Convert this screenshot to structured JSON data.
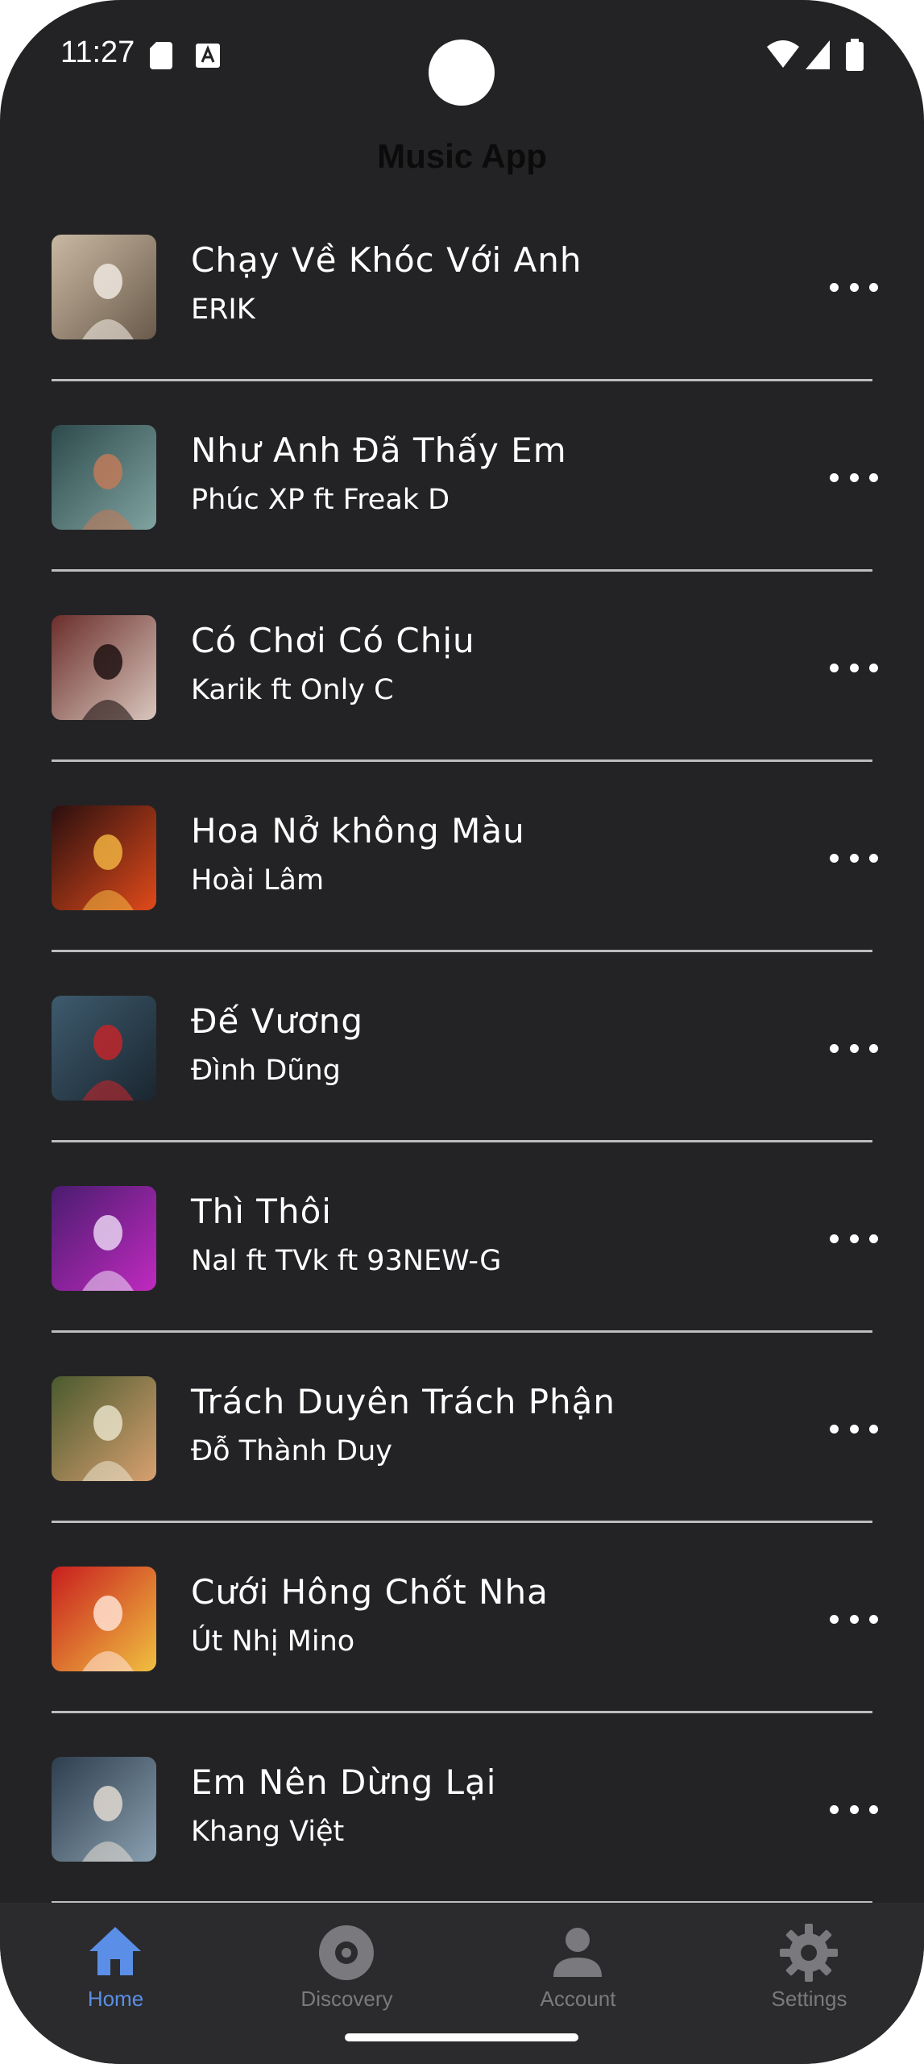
{
  "status_bar": {
    "time": "11:27"
  },
  "app": {
    "title": "Music App"
  },
  "songs": [
    {
      "title": "Chạy Về Khóc Với Anh",
      "artist": "ERIK",
      "cover_colors": [
        "#c9b9a3",
        "#6a5a4a",
        "#efe8df"
      ]
    },
    {
      "title": "Như Anh Đã Thấy Em",
      "artist": "Phúc XP ft Freak D",
      "cover_colors": [
        "#2e4a4c",
        "#7fa3a0",
        "#c07a5a"
      ]
    },
    {
      "title": "Có Chơi Có Chịu",
      "artist": "Karik ft Only C",
      "cover_colors": [
        "#6b2e2a",
        "#d8c6bd",
        "#1e1212"
      ]
    },
    {
      "title": "Hoa Nở không Màu",
      "artist": "Hoài Lâm",
      "cover_colors": [
        "#2a0f0f",
        "#e04a1a",
        "#f0b040"
      ]
    },
    {
      "title": "Đế Vương",
      "artist": "Đình Dũng",
      "cover_colors": [
        "#3e5b6e",
        "#1a2630",
        "#c0262b"
      ]
    },
    {
      "title": "Thì Thôi",
      "artist": "Nal ft TVk ft 93NEW-G",
      "cover_colors": [
        "#4a1c6e",
        "#c02ac0",
        "#e8d0f0"
      ]
    },
    {
      "title": "Trách Duyên Trách Phận",
      "artist": "Đỗ Thành Duy",
      "cover_colors": [
        "#4a5a2e",
        "#d8a070",
        "#e8e0c8"
      ]
    },
    {
      "title": "Cưới Hông Chốt Nha",
      "artist": "Út Nhị Mino",
      "cover_colors": [
        "#c81e1e",
        "#f0c040",
        "#ffe0d0"
      ]
    },
    {
      "title": "Em Nên Dừng Lại",
      "artist": "Khang Việt",
      "cover_colors": [
        "#2e3e4e",
        "#8aa0b0",
        "#e0d8d0"
      ]
    }
  ],
  "bottom_nav": [
    {
      "label": "Home",
      "icon": "home-icon",
      "active": true
    },
    {
      "label": "Discovery",
      "icon": "disc-icon",
      "active": false
    },
    {
      "label": "Account",
      "icon": "person-icon",
      "active": false
    },
    {
      "label": "Settings",
      "icon": "gear-icon",
      "active": false
    }
  ],
  "colors": {
    "background": "#232325",
    "nav_background": "#2b2b2d",
    "accent": "#5b8ee6",
    "inactive": "#7a7a7e",
    "divider": "#bdbdbd"
  }
}
